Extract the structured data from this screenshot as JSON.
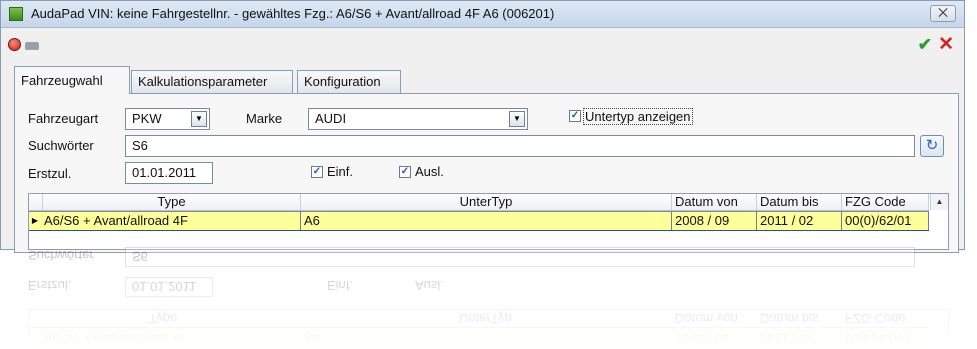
{
  "window": {
    "title": "AudaPad VIN: keine Fahrgestellnr. - gewähltes Fzg.: A6/S6 + Avant/allroad 4F A6 (006201)",
    "close_symbol": "⨉"
  },
  "toolbar": {
    "confirm_symbol": "✔",
    "cancel_symbol": "✕"
  },
  "tabs": [
    {
      "label": "Fahrzeugwahl",
      "active": true
    },
    {
      "label": "Kalkulationsparameter",
      "active": false
    },
    {
      "label": "Konfiguration",
      "active": false
    }
  ],
  "form": {
    "fahrzeugart_label": "Fahrzeugart",
    "fahrzeugart_value": "PKW",
    "marke_label": "Marke",
    "marke_value": "AUDI",
    "untertyp_label": "Untertyp anzeigen",
    "untertyp_checked": true,
    "suchwoerter_label": "Suchwörter",
    "suchwoerter_value": "S6",
    "erstzul_label": "Erstzul.",
    "erstzul_value": "01.01.2011",
    "einf_label": "Einf.",
    "einf_checked": true,
    "ausl_label": "Ausl.",
    "ausl_checked": true
  },
  "grid": {
    "columns": [
      "Type",
      "UnterTyp",
      "Datum von",
      "Datum bis",
      "FZG Code"
    ],
    "rows": [
      [
        "A6/S6 + Avant/allroad 4F",
        "A6",
        "2008 / 09",
        "2011 / 02",
        "00(0)/62/01"
      ]
    ]
  },
  "colors": {
    "selected_row": "#ffff99",
    "check_green": "#2e9c29",
    "cancel_red": "#d62020"
  },
  "icons": {
    "arrow_down": "▼",
    "arrow_up": "▲",
    "row_pointer": "▶",
    "refresh": "↻",
    "check": "✓"
  }
}
